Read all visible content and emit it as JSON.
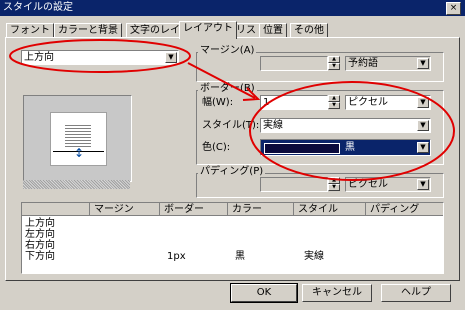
{
  "window": {
    "title": "スタイルの設定",
    "close_glyph": "×"
  },
  "tabs": [
    "フォント",
    "カラーと背景",
    "文字のレイアウト",
    "レイアウト",
    "リスト",
    "位置",
    "その他"
  ],
  "active_tab": "レイアウト",
  "direction_select": {
    "value": "上方向"
  },
  "margin": {
    "legend": "マージン(A)",
    "value": "",
    "unit": "予約語"
  },
  "border": {
    "legend": "ボーダー(B)",
    "width_label": "幅(W):",
    "width_value": "1",
    "width_unit": "ピクセル",
    "style_label": "スタイル(T):",
    "style_value": "実線",
    "color_label": "色(C):",
    "color_value": "黒",
    "color_swatch": "#0a0a3c"
  },
  "padding": {
    "legend": "パディング(P)",
    "value": "",
    "unit": "ピクセル"
  },
  "table": {
    "headers": [
      "",
      "マージン",
      "ボーダー",
      "カラー",
      "スタイル",
      "パディング"
    ],
    "rows": [
      [
        "上方向",
        "",
        "",
        "",
        "",
        ""
      ],
      [
        "左方向",
        "",
        "",
        "",
        "",
        ""
      ],
      [
        "右方向",
        "",
        "",
        "",
        "",
        ""
      ],
      [
        "下方向",
        "",
        "1px",
        "黒",
        "実線",
        ""
      ]
    ]
  },
  "buttons": {
    "ok": "OK",
    "cancel": "キャンセル",
    "help": "ヘルプ"
  },
  "annotation_color": "#e00000"
}
